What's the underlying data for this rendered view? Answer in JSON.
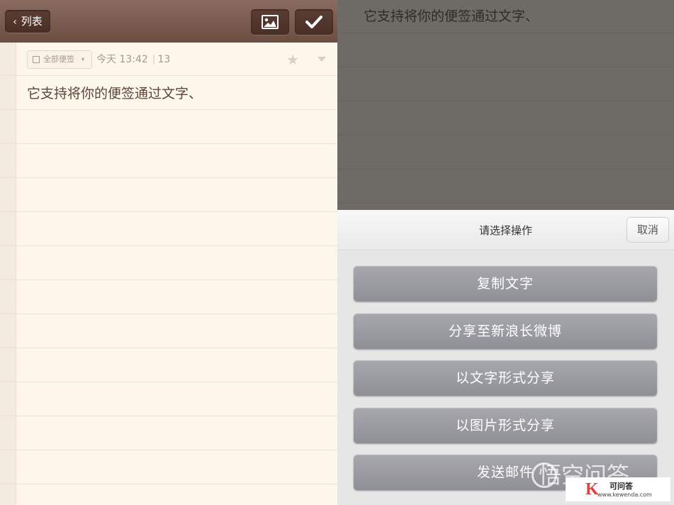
{
  "left_panel": {
    "toolbar": {
      "back_label": "列表",
      "back_icon": "chevron-left-icon",
      "image_icon": "image-icon",
      "check_icon": "checkmark-icon"
    },
    "meta": {
      "category_label": "全部便签",
      "time": "今天 13:42",
      "char_count": "13",
      "star_icon": "star-icon",
      "menu_icon": "caret-down-icon"
    },
    "note_text": "它支持将你的便签通过文字、"
  },
  "right_panel": {
    "dimmed_note_text": "它支持将你的便签通过文字、",
    "action_sheet": {
      "title": "请选择操作",
      "cancel_label": "取消",
      "actions": [
        {
          "label": "复制文字"
        },
        {
          "label": "分享至新浪长微博"
        },
        {
          "label": "以文字形式分享"
        },
        {
          "label": "以图片形式分享"
        },
        {
          "label": "发送邮件"
        }
      ]
    }
  },
  "watermark": {
    "text": "悟空问答",
    "logo_letter": "K",
    "logo_name": "可问答",
    "logo_url": "www.kewenda.com"
  },
  "colors": {
    "toolbar_brown": "#7b5c50",
    "paper": "#fdf6ea",
    "dim_overlay": "#6e6b66",
    "action_button": "#9a9ba1",
    "sheet_bg": "#e6e6e7"
  }
}
